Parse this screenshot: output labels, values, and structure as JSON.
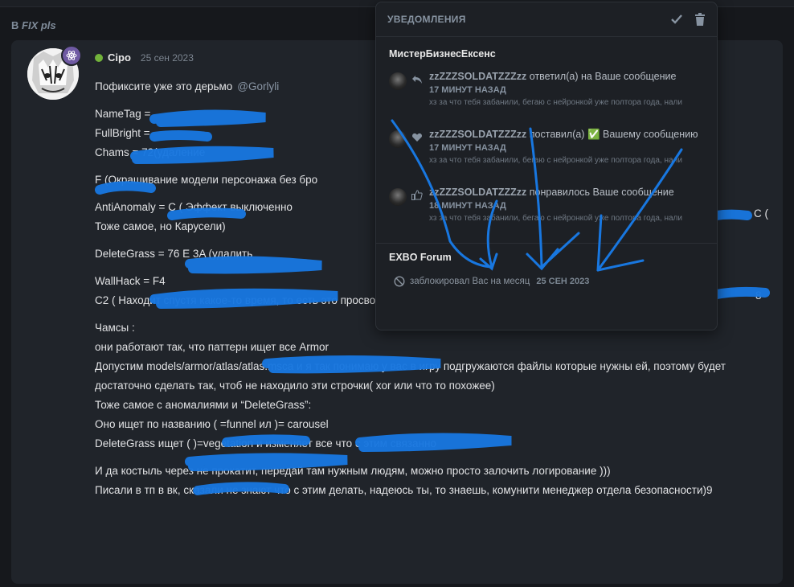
{
  "section": {
    "prefix": "В",
    "title": "FIX pls"
  },
  "post": {
    "author": "Cipo",
    "date": "25 сен 2023",
    "lines": [
      {
        "text": "Пофиксите уже это дерьмо",
        "mention": "@Gorlyli"
      },
      {
        "text": "NameTag = "
      },
      {
        "text": "FullBright = "
      },
      {
        "text": "Chams = 72(удаление"
      },
      {
        "text": "F (Окрашивание модели персонажа без бро"
      },
      {
        "text": "AntiAnomaly = C ( Эффект выключенно"
      },
      {
        "text": "Тоже самое, но Карусели)"
      },
      {
        "text": "DeleteGrass = 76 E 3A (удалить"
      },
      {
        "text": "WallHack = F4"
      },
      {
        "text": "C2 ( Находит спустя какое-то время, то есть это просво"
      },
      {
        "text": "Чамсы :"
      },
      {
        "text": "они работают так, что паттерн ищет все Armor"
      },
      {
        "text": "Допустим models/armor/atlas/atlas.msca и я так понимаю у вас в игру подгружаются файлы которые нужны ей, поэтому будет"
      },
      {
        "text": "достаточно сделать так, чтоб не находило эти строчки( xor или что то похожее)"
      },
      {
        "text": "Тоже самое с аномалиями и “DeleteGrass”:"
      },
      {
        "text": "Оно ищет по названию ( =funnel ил )= carousel"
      },
      {
        "text": "DeleteGrass ищет ( )=vegetation и изменяет все что с этим связанно"
      },
      {
        "text": "И да костыль через не прокатит, передай там нужным людям, можно просто залочить логирование )))"
      },
      {
        "text": "Писали в тп в вк, сказали не знают что с этим делать, надеюсь ты, то знаешь, комунити менеджер отдела безопасности)9"
      }
    ],
    "right_fragments": {
      "antianomaly_tail": "C (",
      "wallhack_tail": "8"
    }
  },
  "notifications": {
    "title": "УВЕДОМЛЕНИЯ",
    "group1": "МистерБизнесЕксенс",
    "items": [
      {
        "user": "zzZZZSOLDATZZZzz",
        "action": "ответил(а) на Ваше сообщение",
        "time": "17 МИНУТ НАЗАД",
        "snippet": "хз за что тебя забанили, бегаю с нейронкой уже полтора года, нали",
        "icon": "reply-icon"
      },
      {
        "user": "zzZZZSOLDATZZZzz",
        "action": "поставил(а) ✅ Вашему сообщению",
        "time": "17 МИНУТ НАЗАД",
        "snippet": "хз за что тебя забанили, бегаю с нейронкой уже полтора года, нали",
        "icon": "heart-icon"
      },
      {
        "user": "zzZZZSOLDATZZZzz",
        "action": "понравилось Ваше сообщение",
        "time": "18 МИНУТ НАЗАД",
        "snippet": "хз за что тебя забанили, бегаю с нейронкой уже полтора года, нали",
        "icon": "thumbs-up-icon"
      }
    ],
    "group2": "EXBO Forum",
    "ban": {
      "text": "заблокировал Вас на месяц",
      "date": "25 СЕН 2023"
    }
  },
  "colors": {
    "scribble": "#1877e0",
    "online": "#72b33b",
    "badge": "#6f5aa3"
  }
}
